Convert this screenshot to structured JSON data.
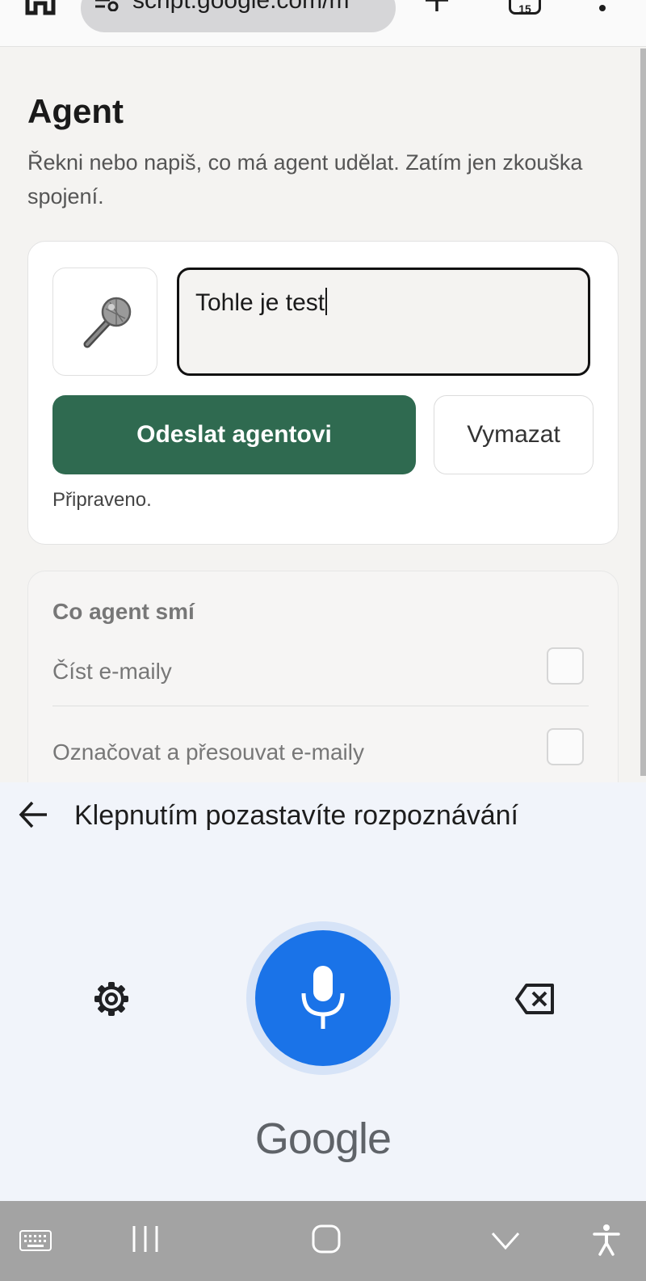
{
  "browser": {
    "url": "script.google.com/m",
    "tab_count": "15"
  },
  "page": {
    "title": "Agent",
    "description": "Řekni nebo napiš, co má agent udělat. Zatím jen zkouška spojení."
  },
  "command_card": {
    "input_value": "Tohle je test",
    "send_label": "Odeslat agentovi",
    "clear_label": "Vymazat",
    "status": "Připraveno."
  },
  "permissions": {
    "title": "Co agent smí",
    "items": [
      {
        "label": "Číst e-maily",
        "checked": false
      },
      {
        "label": "Označovat a přesouvat e-maily",
        "checked": false
      }
    ]
  },
  "voice_input": {
    "status": "Klepnutím pozastavíte rozpoznávání",
    "brand": "Google",
    "accent_color": "#1a73e8"
  },
  "colors": {
    "send_button": "#2f6a50",
    "background": "#f4f3f1"
  }
}
